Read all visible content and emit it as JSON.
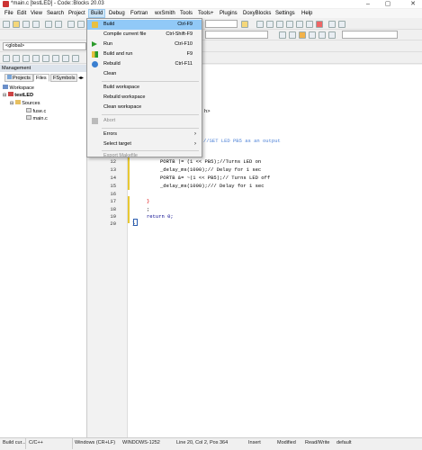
{
  "window": {
    "title": "*main.c [testLED] - Code::Blocks 20.03"
  },
  "menubar": [
    "File",
    "Edit",
    "View",
    "Search",
    "Project",
    "Build",
    "Debug",
    "Fortran",
    "wxSmith",
    "Tools",
    "Tools+",
    "Plugins",
    "DoxyBlocks",
    "Settings",
    "Help"
  ],
  "toolbar": {
    "scope_combo": "<global>"
  },
  "management": {
    "title": "Management",
    "tabs": [
      "Projects",
      "Files",
      "FSymbols"
    ],
    "tree": {
      "workspace": "Workspace",
      "project": "testLED",
      "folder": "Sources",
      "files": [
        "fuse.c",
        "main.c"
      ]
    }
  },
  "build_menu": {
    "items": [
      {
        "label": "Build",
        "shortcut": "Ctrl-F9"
      },
      {
        "label": "Compile current file",
        "shortcut": "Ctrl-Shift-F9"
      },
      {
        "label": "Run",
        "shortcut": "Ctrl-F10"
      },
      {
        "label": "Build and run",
        "shortcut": "F9"
      },
      {
        "label": "Rebuild",
        "shortcut": "Ctrl-F11"
      },
      {
        "label": "Clean",
        "shortcut": ""
      },
      {
        "label": "Build workspace",
        "shortcut": ""
      },
      {
        "label": "Rebuild workspace",
        "shortcut": ""
      },
      {
        "label": "Clean workspace",
        "shortcut": ""
      },
      {
        "label": "Abort",
        "shortcut": ""
      },
      {
        "label": "Errors",
        "shortcut": ""
      },
      {
        "label": "Select target",
        "shortcut": ""
      },
      {
        "label": "Export Makefile",
        "shortcut": ""
      }
    ]
  },
  "editor": {
    "partial": {
      "include_tail": "h>",
      "comment_tail": "//SET LED PB5 as an output"
    },
    "lines": [
      {
        "n": "12",
        "code": "PORTB |= (1 << PB5);//Turns LED on"
      },
      {
        "n": "13",
        "code": "_delay_ms(1000);// Delay for 1 sec"
      },
      {
        "n": "14",
        "code": "PORTB &= ~(1 << PB5);// Turns LED off"
      },
      {
        "n": "15",
        "code": "_delay_ms(1000);/// Delay for 1 sec"
      },
      {
        "n": "16",
        "code": ""
      },
      {
        "n": "17",
        "code": "}"
      },
      {
        "n": "18",
        "code": ";"
      },
      {
        "n": "19",
        "code": "return 0;"
      },
      {
        "n": "20",
        "code": "}"
      }
    ]
  },
  "statusbar": {
    "left": "Build cur...",
    "language": "C/C++",
    "eol": "Windows (CR+LF)",
    "encoding": "WINDOWS-1252",
    "position": "Line 20, Col 2, Pos 364",
    "mode": "Insert",
    "modified": "Modified",
    "access": "Read/Write",
    "profile": "default"
  }
}
